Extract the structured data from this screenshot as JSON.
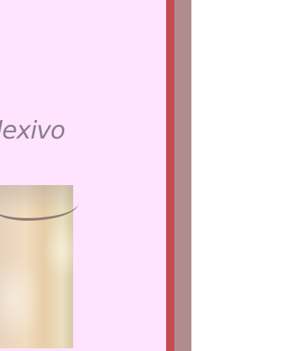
{
  "page": {
    "heading_fragment": "lexivo"
  },
  "colors": {
    "panel_background": "#ffe3ff",
    "heading_text": "#8c7e8c",
    "border_red": "#c54c50",
    "border_mauve": "#b08c8e"
  },
  "image": {
    "description_icon": "photo-image"
  }
}
